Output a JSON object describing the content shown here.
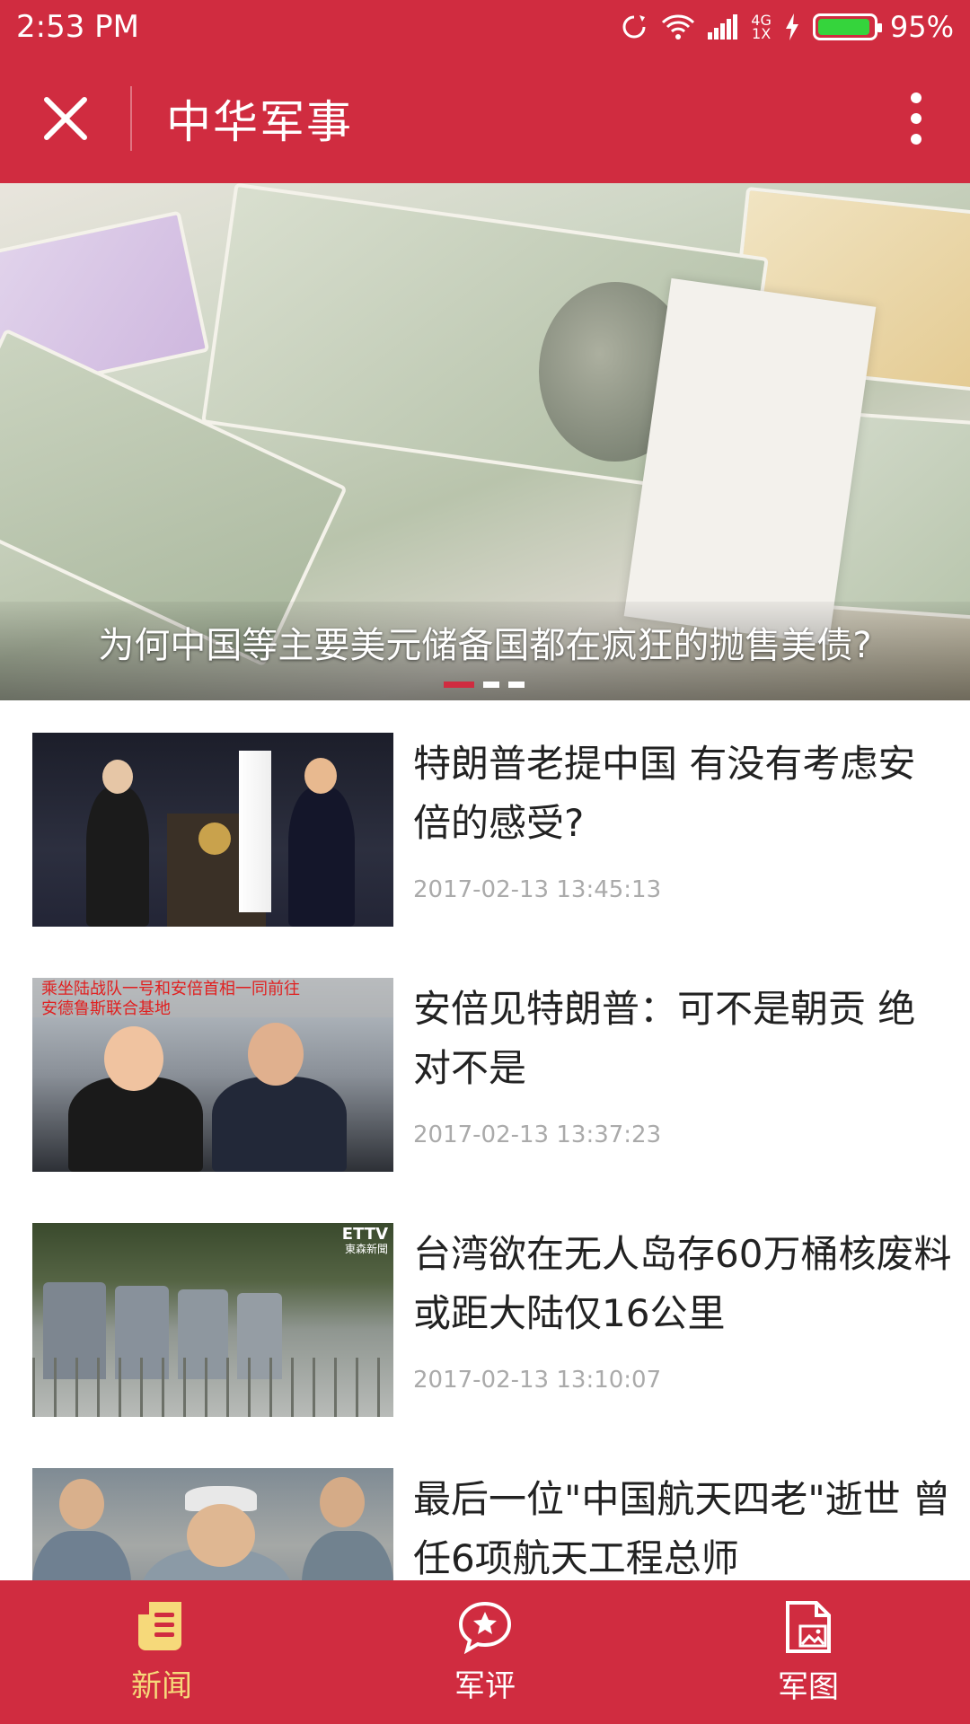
{
  "status_bar": {
    "time": "2:53 PM",
    "network_top": "4G",
    "network_bottom": "1X",
    "battery_percent": "95%",
    "battery_level": 0.95
  },
  "app_bar": {
    "title": "中华军事",
    "close_icon": "close-icon",
    "more_icon": "more-vertical-icon"
  },
  "banner": {
    "title": "为何中国等主要美元储备国都在疯狂的抛售美债?",
    "slide_count": 3,
    "active_slide": 1
  },
  "news": [
    {
      "title": "特朗普老提中国 有没有考虑安倍的感受?",
      "time": "2017-02-13 13:45:13"
    },
    {
      "title": "安倍见特朗普：可不是朝贡 绝对不是",
      "time": "2017-02-13 13:37:23",
      "thumb_caption_1": "乘坐陆战队一号和安倍首相一同前往",
      "thumb_caption_2": "安德鲁斯联合基地"
    },
    {
      "title": "台湾欲在无人岛存60万桶核废料 或距大陆仅16公里",
      "time": "2017-02-13 13:10:07",
      "thumb_logo": "ETTV",
      "thumb_logo_sub": "東森新聞"
    },
    {
      "title": "最后一位\"中国航天四老\"逝世 曾任6项航天工程总师",
      "time": ""
    }
  ],
  "bottom_nav": [
    {
      "label": "新闻",
      "icon": "news-document-icon",
      "active": true
    },
    {
      "label": "军评",
      "icon": "comment-star-icon",
      "active": false
    },
    {
      "label": "军图",
      "icon": "image-document-icon",
      "active": false
    }
  ],
  "colors": {
    "primary": "#d02c40",
    "active_nav": "#f6d97a",
    "battery": "#35d43c"
  }
}
